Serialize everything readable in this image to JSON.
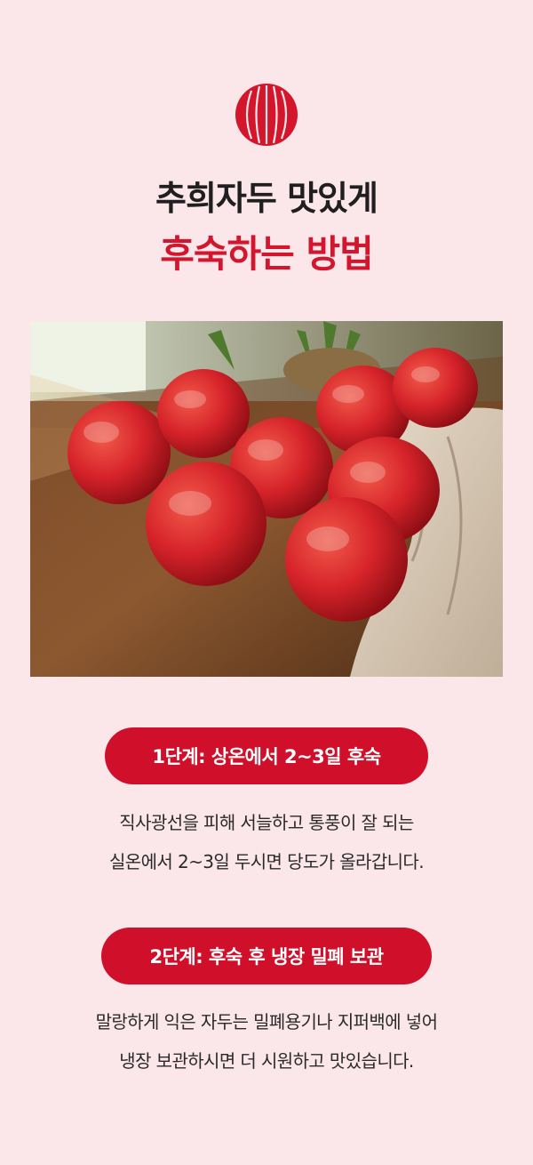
{
  "header": {
    "icon": "plum-icon",
    "title_line1": "추희자두 맛있게",
    "title_line2": "후숙하는 방법"
  },
  "photo": {
    "subject": "plums-on-wooden-table"
  },
  "steps": [
    {
      "label": "1단계: 상온에서 2~3일 후숙",
      "lines": [
        "직사광선을 피해 서늘하고 통풍이 잘 되는",
        "실온에서 2~3일 두시면 당도가 올라갑니다."
      ]
    },
    {
      "label": "2단계: 후숙 후 냉장 밀폐 보관",
      "lines": [
        "말랑하게 익은 자두는 밀폐용기나 지퍼백에 넣어",
        "냉장 보관하시면 더 시원하고 맛있습니다."
      ]
    }
  ],
  "colors": {
    "background": "#fbe6ea",
    "accent": "#d0102a",
    "title_dark": "#1f1f1f"
  }
}
